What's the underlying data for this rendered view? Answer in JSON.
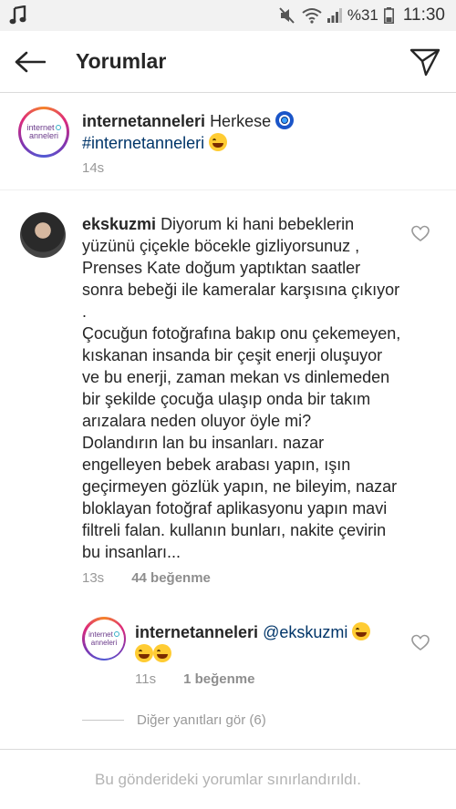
{
  "status_bar": {
    "battery_pct": "%31",
    "time": "11:30"
  },
  "header": {
    "title": "Yorumlar"
  },
  "caption": {
    "username": "internetanneleri",
    "text": "Herkese",
    "hashtag": "#internetanneleri",
    "time": "14s",
    "logo_line1": "internet",
    "logo_line2": "anneleri"
  },
  "comments": [
    {
      "username": "ekskuzmi",
      "text": "Diyorum ki hani bebeklerin yüzünü çiçekle böcekle gizliyorsunuz , Prenses Kate doğum yaptıktan saatler sonra bebeği ile kameralar karşısına çıkıyor .\nÇocuğun fotoğrafına bakıp onu çekemeyen, kıskanan insanda bir çeşit enerji oluşuyor ve bu enerji, zaman mekan vs dinlemeden bir şekilde çocuğa ulaşıp onda bir takım arızalara neden oluyor öyle mi?\nDolandırın lan bu insanları. nazar engelleyen bebek arabası yapın, ışın geçirmeyen gözlük yapın, ne bileyim, nazar bloklayan fotoğraf aplikasyonu yapın mavi filtreli falan. kullanın bunları, nakite çevirin bu insanları...",
      "time": "13s",
      "likes": "44 beğenme"
    }
  ],
  "reply": {
    "username": "internetanneleri",
    "mention": "@ekskuzmi",
    "time": "11s",
    "likes": "1 beğenme"
  },
  "view_replies": "Diğer yanıtları gör (6)",
  "footer": "Bu gönderideki yorumlar sınırlandırıldı.",
  "icons": {
    "back": "arrow-left-icon",
    "send": "paper-plane-icon",
    "like": "heart-outline-icon"
  }
}
